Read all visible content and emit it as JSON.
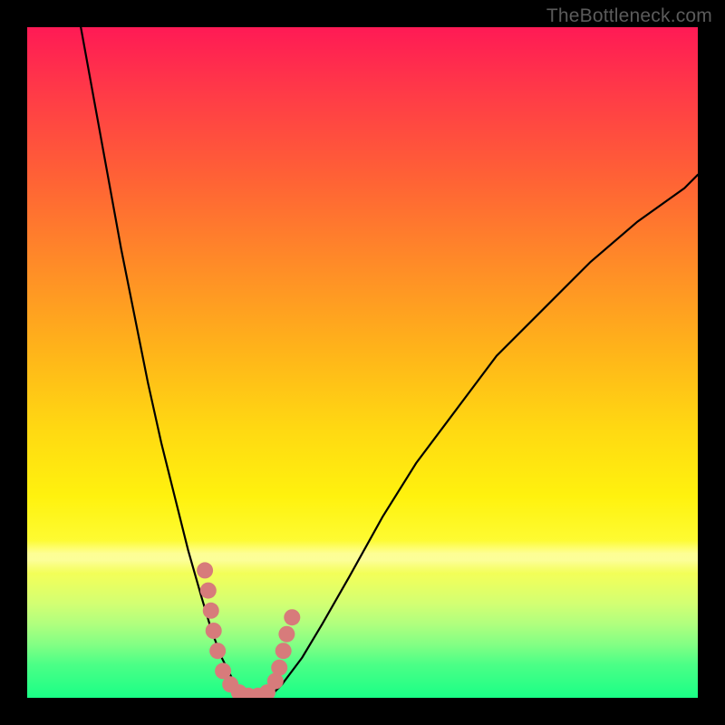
{
  "watermark": "TheBottleneck.com",
  "chart_data": {
    "type": "line",
    "title": "",
    "xlabel": "",
    "ylabel": "",
    "xlim": [
      0,
      100
    ],
    "ylim": [
      0,
      100
    ],
    "grid": false,
    "background_gradient": [
      "#ff1a55",
      "#ffb31a",
      "#fff20e",
      "#1aff86"
    ],
    "series": [
      {
        "name": "left-curve",
        "x": [
          8,
          10,
          12,
          14,
          16,
          18,
          20,
          22,
          24,
          26,
          27.5,
          29,
          30.5,
          31.5,
          32.5
        ],
        "y": [
          100,
          89,
          78,
          67,
          57,
          47,
          38,
          30,
          22,
          15,
          10,
          6,
          3,
          1,
          0
        ],
        "stroke": "#000000",
        "width": 2.2
      },
      {
        "name": "right-curve",
        "x": [
          36,
          38,
          41,
          44,
          48,
          53,
          58,
          64,
          70,
          77,
          84,
          91,
          98,
          100
        ],
        "y": [
          0,
          2,
          6,
          11,
          18,
          27,
          35,
          43,
          51,
          58,
          65,
          71,
          76,
          78
        ],
        "stroke": "#000000",
        "width": 2.2
      }
    ],
    "annotations": [
      {
        "name": "valley-markers",
        "type": "scatter",
        "color": "#d77b7b",
        "points": [
          {
            "x": 26.5,
            "y": 19
          },
          {
            "x": 27.0,
            "y": 16
          },
          {
            "x": 27.4,
            "y": 13
          },
          {
            "x": 27.8,
            "y": 10
          },
          {
            "x": 28.4,
            "y": 7
          },
          {
            "x": 29.2,
            "y": 4
          },
          {
            "x": 30.3,
            "y": 2
          },
          {
            "x": 31.6,
            "y": 0.8
          },
          {
            "x": 33.0,
            "y": 0.3
          },
          {
            "x": 34.4,
            "y": 0.3
          },
          {
            "x": 35.8,
            "y": 0.8
          },
          {
            "x": 37.0,
            "y": 2.5
          },
          {
            "x": 37.6,
            "y": 4.5
          },
          {
            "x": 38.2,
            "y": 7
          },
          {
            "x": 38.7,
            "y": 9.5
          },
          {
            "x": 39.5,
            "y": 12
          }
        ]
      }
    ]
  }
}
